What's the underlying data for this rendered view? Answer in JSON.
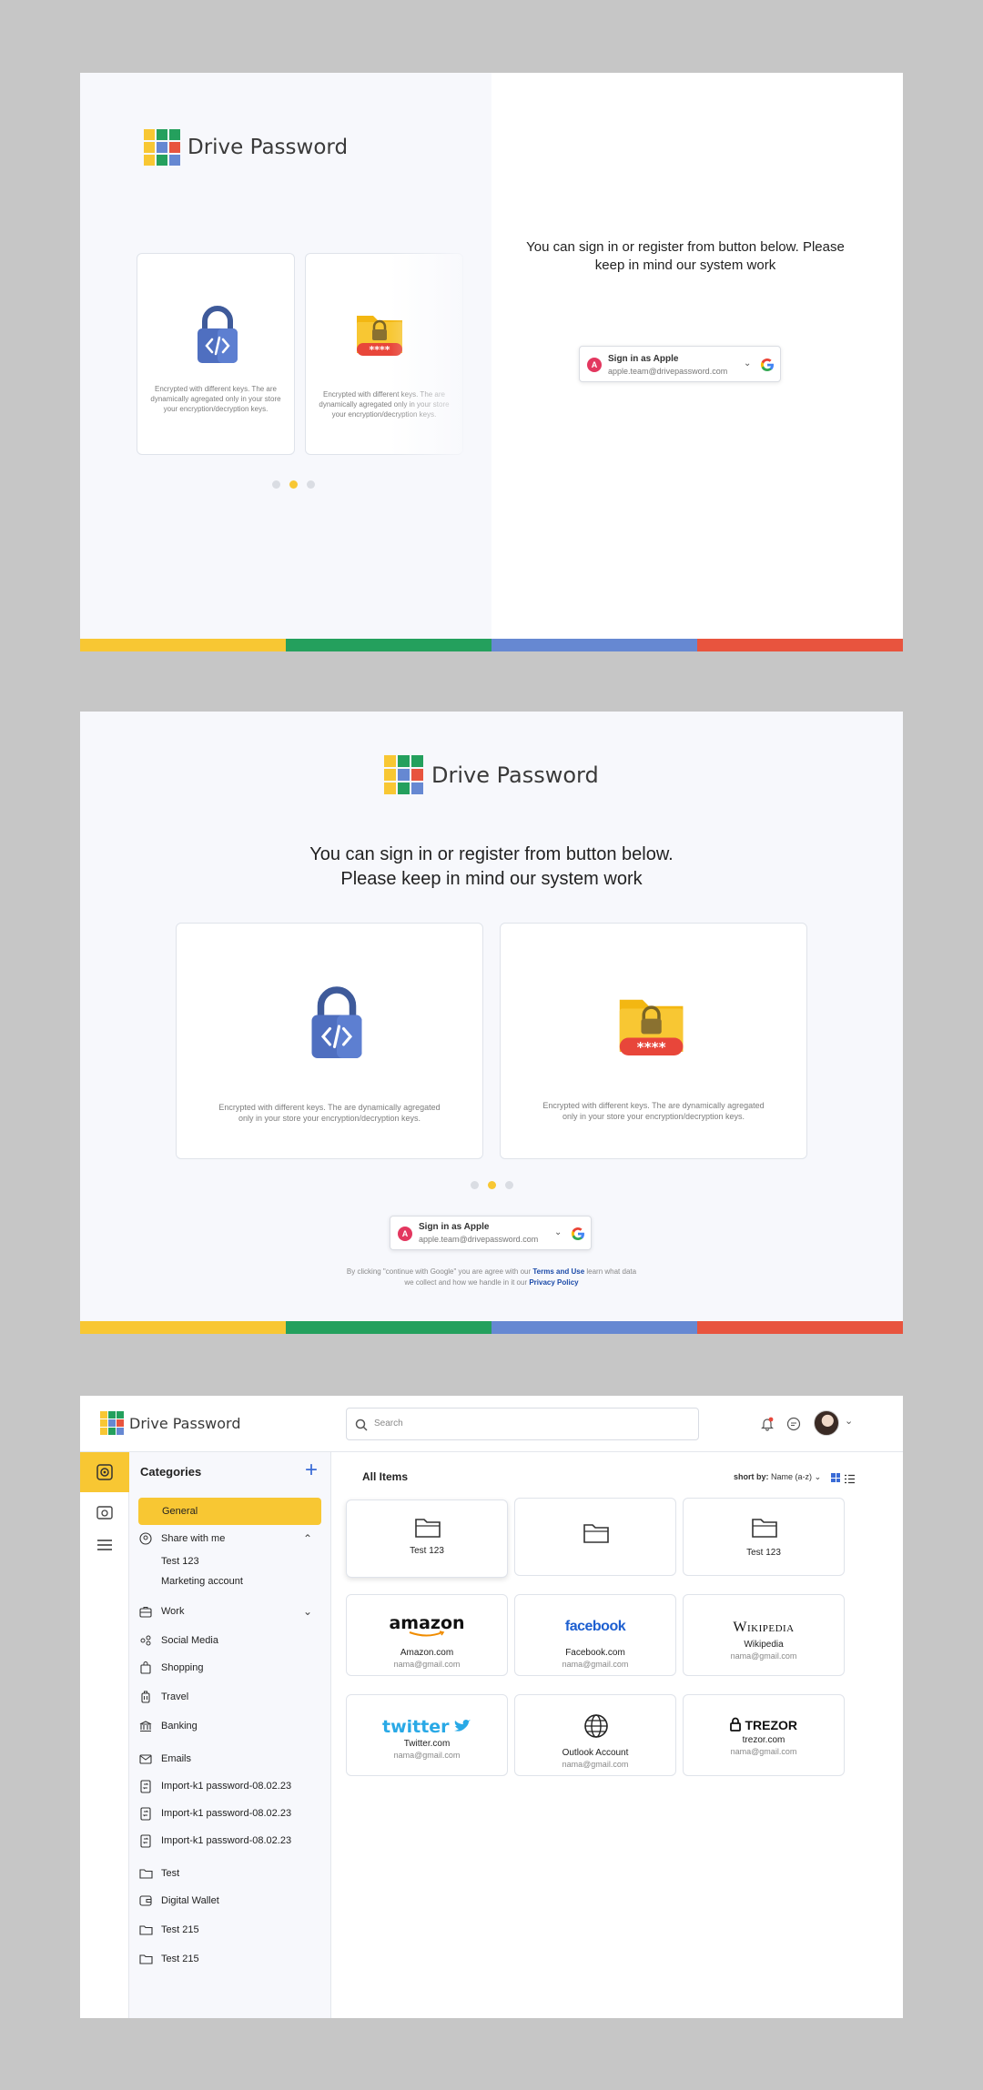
{
  "colors": {
    "yellow": "#f8c733",
    "green": "#24a05d",
    "blue": "#6688d2",
    "red": "#e8543e",
    "accent_blue": "#1b4aa8"
  },
  "brand": {
    "name": "Drive Password"
  },
  "login": {
    "heading": "You can sign in or register from button below. Please keep in mind our system work",
    "heading_line1": "You can sign in or register from button below.",
    "heading_line2": "Please keep in mind our system work",
    "feature_text": "Encrypted with different keys. The are dynamically agregated only in your store your encryption/decryption keys.",
    "features": [
      {
        "icon": "code-lock-icon"
      },
      {
        "icon": "password-folder-icon"
      }
    ],
    "slides": 3,
    "active_slide": 2,
    "signin": {
      "avatar_letter": "A",
      "title": "Sign in as Apple",
      "email": "apple.team@drivepassword.com",
      "provider_icon": "google-icon"
    },
    "legal": {
      "part1": "By clicking \"continue with Google\" you are agree with our ",
      "terms": "Terms and Use",
      "part2": " learn what data",
      "part3": "we collect and how we handle in it our ",
      "privacy": "Privacy Policy"
    },
    "pin_stars": "****"
  },
  "app": {
    "search_placeholder": "Search",
    "sidebar_title": "Categories",
    "categories": [
      {
        "label": "General",
        "icon": "",
        "active": true
      },
      {
        "label": "Share with me",
        "icon": "share-icon",
        "expanded": true
      },
      {
        "label": "Test 123",
        "sub": true
      },
      {
        "label": "Marketing account",
        "sub": true
      },
      {
        "label": "Work",
        "icon": "briefcase-icon",
        "collapsed": true
      },
      {
        "label": "Social Media",
        "icon": "social-icon"
      },
      {
        "label": "Shopping",
        "icon": "shopping-bag-icon"
      },
      {
        "label": "Travel",
        "icon": "luggage-icon"
      },
      {
        "label": "Banking",
        "icon": "bank-icon"
      },
      {
        "label": "Emails",
        "icon": "mail-icon"
      },
      {
        "label": "Import-k1 password-08.02.23",
        "icon": "import-file-icon"
      },
      {
        "label": "Import-k1 password-08.02.23",
        "icon": "import-file-icon"
      },
      {
        "label": "Import-k1 password-08.02.23",
        "icon": "import-file-icon"
      },
      {
        "label": "Test",
        "icon": "folder-icon"
      },
      {
        "label": "Digital Wallet",
        "icon": "wallet-icon"
      },
      {
        "label": "Test 215",
        "icon": "folder-icon"
      },
      {
        "label": "Test 215",
        "icon": "folder-icon"
      }
    ],
    "main_title": "All Items",
    "sort_prefix": "short by:",
    "sort_value": "Name (a-z)",
    "folders": [
      {
        "label": "Test 123"
      },
      {
        "label": ""
      },
      {
        "label": "Test 123"
      }
    ],
    "items": [
      {
        "brand": "amazon",
        "name": "Amazon.com",
        "email": "nama@gmail.com"
      },
      {
        "brand": "facebook",
        "name": "Facebook.com",
        "email": "nama@gmail.com"
      },
      {
        "brand": "Wikipedia",
        "name": "Wikipedia",
        "email": "nama@gmail.com"
      },
      {
        "brand": "twitter",
        "name": "Twitter.com",
        "email": "nama@gmail.com"
      },
      {
        "brand": "",
        "name": "Outlook Account",
        "email": "nama@gmail.com"
      },
      {
        "brand": "TREZOR",
        "name": "trezor.com",
        "email": "nama@gmail.com"
      }
    ]
  }
}
